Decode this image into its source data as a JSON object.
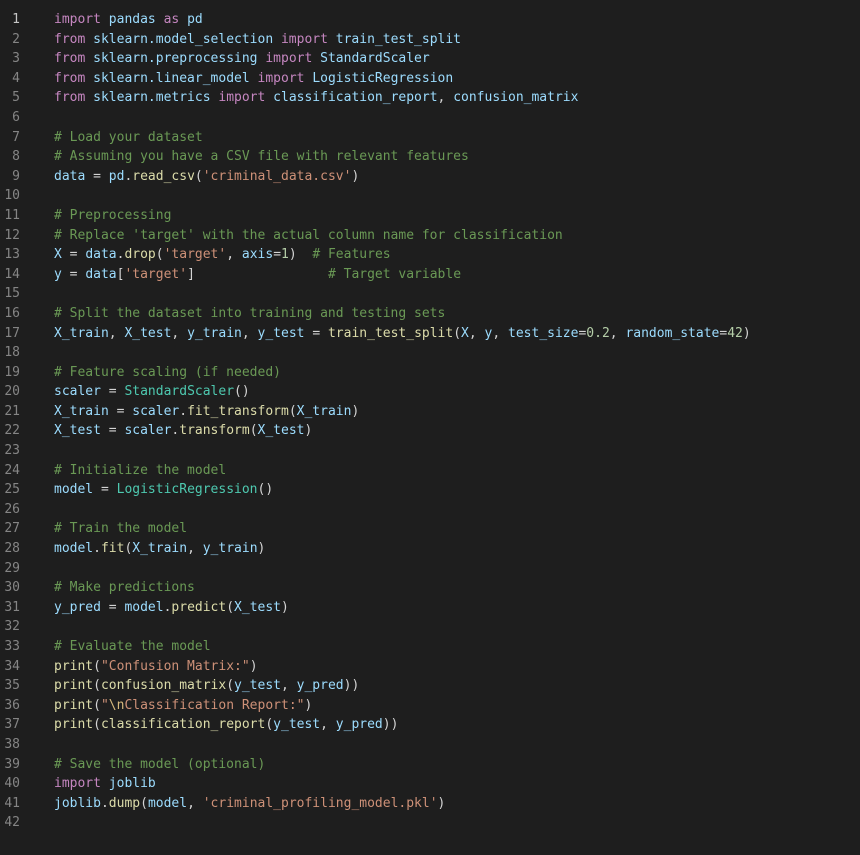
{
  "editor": {
    "language": "python",
    "active_line": 1,
    "colors": {
      "background": "#1e1e1e",
      "line_number": "#858585",
      "keyword": "#569cd6",
      "import_keyword": "#c586c0",
      "string": "#ce9178",
      "number": "#b5cea8",
      "comment": "#6a9955",
      "variable": "#9cdcfe",
      "function": "#dcdcaa",
      "class": "#4ec9b0",
      "text": "#d4d4d4"
    },
    "lines": [
      {
        "n": "1",
        "tokens": [
          [
            "kw2",
            "import"
          ],
          [
            "plain",
            " "
          ],
          [
            "var",
            "pandas"
          ],
          [
            "plain",
            " "
          ],
          [
            "kw2",
            "as"
          ],
          [
            "plain",
            " "
          ],
          [
            "var",
            "pd"
          ]
        ]
      },
      {
        "n": "2",
        "tokens": [
          [
            "kw2",
            "from"
          ],
          [
            "plain",
            " "
          ],
          [
            "var",
            "sklearn.model_selection"
          ],
          [
            "plain",
            " "
          ],
          [
            "kw2",
            "import"
          ],
          [
            "plain",
            " "
          ],
          [
            "var",
            "train_test_split"
          ]
        ]
      },
      {
        "n": "3",
        "tokens": [
          [
            "kw2",
            "from"
          ],
          [
            "plain",
            " "
          ],
          [
            "var",
            "sklearn.preprocessing"
          ],
          [
            "plain",
            " "
          ],
          [
            "kw2",
            "import"
          ],
          [
            "plain",
            " "
          ],
          [
            "var",
            "StandardScaler"
          ]
        ]
      },
      {
        "n": "4",
        "tokens": [
          [
            "kw2",
            "from"
          ],
          [
            "plain",
            " "
          ],
          [
            "var",
            "sklearn.linear_model"
          ],
          [
            "plain",
            " "
          ],
          [
            "kw2",
            "import"
          ],
          [
            "plain",
            " "
          ],
          [
            "var",
            "LogisticRegression"
          ]
        ]
      },
      {
        "n": "5",
        "tokens": [
          [
            "kw2",
            "from"
          ],
          [
            "plain",
            " "
          ],
          [
            "var",
            "sklearn.metrics"
          ],
          [
            "plain",
            " "
          ],
          [
            "kw2",
            "import"
          ],
          [
            "plain",
            " "
          ],
          [
            "var",
            "classification_report"
          ],
          [
            "plain",
            ", "
          ],
          [
            "var",
            "confusion_matrix"
          ]
        ]
      },
      {
        "n": "6",
        "tokens": []
      },
      {
        "n": "7",
        "tokens": [
          [
            "cmt",
            "# Load your dataset"
          ]
        ]
      },
      {
        "n": "8",
        "tokens": [
          [
            "cmt",
            "# Assuming you have a CSV file with relevant features"
          ]
        ]
      },
      {
        "n": "9",
        "tokens": [
          [
            "var",
            "data"
          ],
          [
            "plain",
            " = "
          ],
          [
            "var",
            "pd"
          ],
          [
            "plain",
            "."
          ],
          [
            "fn",
            "read_csv"
          ],
          [
            "plain",
            "("
          ],
          [
            "str",
            "'criminal_data.csv'"
          ],
          [
            "plain",
            ")"
          ]
        ]
      },
      {
        "n": "10",
        "tokens": []
      },
      {
        "n": "11",
        "tokens": [
          [
            "cmt",
            "# Preprocessing"
          ]
        ]
      },
      {
        "n": "12",
        "tokens": [
          [
            "cmt",
            "# Replace 'target' with the actual column name for classification"
          ]
        ]
      },
      {
        "n": "13",
        "tokens": [
          [
            "var",
            "X"
          ],
          [
            "plain",
            " = "
          ],
          [
            "var",
            "data"
          ],
          [
            "plain",
            "."
          ],
          [
            "fn",
            "drop"
          ],
          [
            "plain",
            "("
          ],
          [
            "str",
            "'target'"
          ],
          [
            "plain",
            ", "
          ],
          [
            "var",
            "axis"
          ],
          [
            "plain",
            "="
          ],
          [
            "num",
            "1"
          ],
          [
            "plain",
            ")  "
          ],
          [
            "cmt",
            "# Features"
          ]
        ]
      },
      {
        "n": "14",
        "tokens": [
          [
            "var",
            "y"
          ],
          [
            "plain",
            " = "
          ],
          [
            "var",
            "data"
          ],
          [
            "plain",
            "["
          ],
          [
            "str",
            "'target'"
          ],
          [
            "plain",
            "]                 "
          ],
          [
            "cmt",
            "# Target variable"
          ]
        ]
      },
      {
        "n": "15",
        "tokens": []
      },
      {
        "n": "16",
        "tokens": [
          [
            "cmt",
            "# Split the dataset into training and testing sets"
          ]
        ]
      },
      {
        "n": "17",
        "tokens": [
          [
            "var",
            "X_train"
          ],
          [
            "plain",
            ", "
          ],
          [
            "var",
            "X_test"
          ],
          [
            "plain",
            ", "
          ],
          [
            "var",
            "y_train"
          ],
          [
            "plain",
            ", "
          ],
          [
            "var",
            "y_test"
          ],
          [
            "plain",
            " = "
          ],
          [
            "fn",
            "train_test_split"
          ],
          [
            "plain",
            "("
          ],
          [
            "var",
            "X"
          ],
          [
            "plain",
            ", "
          ],
          [
            "var",
            "y"
          ],
          [
            "plain",
            ", "
          ],
          [
            "var",
            "test_size"
          ],
          [
            "plain",
            "="
          ],
          [
            "num",
            "0.2"
          ],
          [
            "plain",
            ", "
          ],
          [
            "var",
            "random_state"
          ],
          [
            "plain",
            "="
          ],
          [
            "num",
            "42"
          ],
          [
            "plain",
            ")"
          ]
        ]
      },
      {
        "n": "18",
        "tokens": []
      },
      {
        "n": "19",
        "tokens": [
          [
            "cmt",
            "# Feature scaling (if needed)"
          ]
        ]
      },
      {
        "n": "20",
        "tokens": [
          [
            "var",
            "scaler"
          ],
          [
            "plain",
            " = "
          ],
          [
            "cls",
            "StandardScaler"
          ],
          [
            "plain",
            "()"
          ]
        ]
      },
      {
        "n": "21",
        "tokens": [
          [
            "var",
            "X_train"
          ],
          [
            "plain",
            " = "
          ],
          [
            "var",
            "scaler"
          ],
          [
            "plain",
            "."
          ],
          [
            "fn",
            "fit_transform"
          ],
          [
            "plain",
            "("
          ],
          [
            "var",
            "X_train"
          ],
          [
            "plain",
            ")"
          ]
        ]
      },
      {
        "n": "22",
        "tokens": [
          [
            "var",
            "X_test"
          ],
          [
            "plain",
            " = "
          ],
          [
            "var",
            "scaler"
          ],
          [
            "plain",
            "."
          ],
          [
            "fn",
            "transform"
          ],
          [
            "plain",
            "("
          ],
          [
            "var",
            "X_test"
          ],
          [
            "plain",
            ")"
          ]
        ]
      },
      {
        "n": "23",
        "tokens": []
      },
      {
        "n": "24",
        "tokens": [
          [
            "cmt",
            "# Initialize the model"
          ]
        ]
      },
      {
        "n": "25",
        "tokens": [
          [
            "var",
            "model"
          ],
          [
            "plain",
            " = "
          ],
          [
            "cls",
            "LogisticRegression"
          ],
          [
            "plain",
            "()"
          ]
        ]
      },
      {
        "n": "26",
        "tokens": []
      },
      {
        "n": "27",
        "tokens": [
          [
            "cmt",
            "# Train the model"
          ]
        ]
      },
      {
        "n": "28",
        "tokens": [
          [
            "var",
            "model"
          ],
          [
            "plain",
            "."
          ],
          [
            "fn",
            "fit"
          ],
          [
            "plain",
            "("
          ],
          [
            "var",
            "X_train"
          ],
          [
            "plain",
            ", "
          ],
          [
            "var",
            "y_train"
          ],
          [
            "plain",
            ")"
          ]
        ]
      },
      {
        "n": "29",
        "tokens": []
      },
      {
        "n": "30",
        "tokens": [
          [
            "cmt",
            "# Make predictions"
          ]
        ]
      },
      {
        "n": "31",
        "tokens": [
          [
            "var",
            "y_pred"
          ],
          [
            "plain",
            " = "
          ],
          [
            "var",
            "model"
          ],
          [
            "plain",
            "."
          ],
          [
            "fn",
            "predict"
          ],
          [
            "plain",
            "("
          ],
          [
            "var",
            "X_test"
          ],
          [
            "plain",
            ")"
          ]
        ]
      },
      {
        "n": "32",
        "tokens": []
      },
      {
        "n": "33",
        "tokens": [
          [
            "cmt",
            "# Evaluate the model"
          ]
        ]
      },
      {
        "n": "34",
        "tokens": [
          [
            "fn",
            "print"
          ],
          [
            "plain",
            "("
          ],
          [
            "str",
            "\"Confusion Matrix:\""
          ],
          [
            "plain",
            ")"
          ]
        ]
      },
      {
        "n": "35",
        "tokens": [
          [
            "fn",
            "print"
          ],
          [
            "plain",
            "("
          ],
          [
            "fn",
            "confusion_matrix"
          ],
          [
            "plain",
            "("
          ],
          [
            "var",
            "y_test"
          ],
          [
            "plain",
            ", "
          ],
          [
            "var",
            "y_pred"
          ],
          [
            "plain",
            "))"
          ]
        ]
      },
      {
        "n": "36",
        "tokens": [
          [
            "fn",
            "print"
          ],
          [
            "plain",
            "("
          ],
          [
            "str",
            "\""
          ],
          [
            "esc",
            "\\n"
          ],
          [
            "str",
            "Classification Report:\""
          ],
          [
            "plain",
            ")"
          ]
        ]
      },
      {
        "n": "37",
        "tokens": [
          [
            "fn",
            "print"
          ],
          [
            "plain",
            "("
          ],
          [
            "fn",
            "classification_report"
          ],
          [
            "plain",
            "("
          ],
          [
            "var",
            "y_test"
          ],
          [
            "plain",
            ", "
          ],
          [
            "var",
            "y_pred"
          ],
          [
            "plain",
            "))"
          ]
        ]
      },
      {
        "n": "38",
        "tokens": []
      },
      {
        "n": "39",
        "tokens": [
          [
            "cmt",
            "# Save the model (optional)"
          ]
        ]
      },
      {
        "n": "40",
        "tokens": [
          [
            "kw2",
            "import"
          ],
          [
            "plain",
            " "
          ],
          [
            "var",
            "joblib"
          ]
        ]
      },
      {
        "n": "41",
        "tokens": [
          [
            "var",
            "joblib"
          ],
          [
            "plain",
            "."
          ],
          [
            "fn",
            "dump"
          ],
          [
            "plain",
            "("
          ],
          [
            "var",
            "model"
          ],
          [
            "plain",
            ", "
          ],
          [
            "str",
            "'criminal_profiling_model.pkl'"
          ],
          [
            "plain",
            ")"
          ]
        ]
      },
      {
        "n": "42",
        "tokens": []
      }
    ]
  }
}
